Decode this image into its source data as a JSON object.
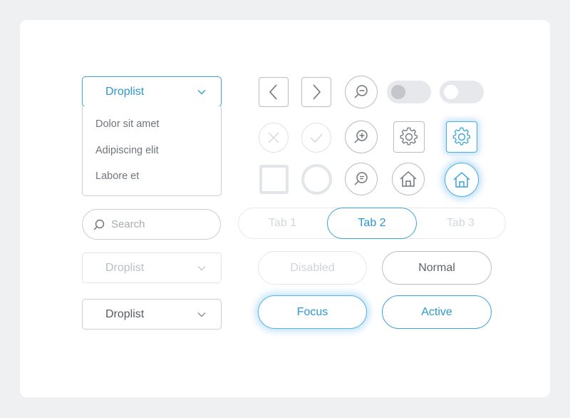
{
  "colors": {
    "accent": "#3ba3d8",
    "border": "#c9ced3",
    "disabled": "#e2e5e8",
    "background": "#eef0f2"
  },
  "dropdown_open": {
    "label": "Droplist",
    "icon": "chevron-down-icon",
    "options": [
      "Dolor sit amet",
      "Adipiscing elit",
      "Labore et"
    ]
  },
  "search": {
    "placeholder": "Search",
    "icon": "search-icon"
  },
  "dropdown_disabled": {
    "label": "Droplist",
    "icon": "chevron-down-icon"
  },
  "dropdown_normal": {
    "label": "Droplist",
    "icon": "chevron-down-icon"
  },
  "icons": {
    "row1": [
      "chevron-left-icon",
      "chevron-right-icon",
      "zoom-out-icon",
      "toggle-off",
      "toggle-off-white"
    ],
    "row2": [
      "close-icon",
      "check-icon",
      "zoom-in-icon",
      "gear-icon",
      "gear-icon-focused"
    ],
    "row3": [
      "empty-square",
      "empty-circle",
      "chat-search-icon",
      "home-icon",
      "home-icon-focused"
    ]
  },
  "tabs": {
    "items": [
      "Tab 1",
      "Tab 2",
      "Tab 3"
    ],
    "active_label": "Tab 2"
  },
  "buttons": {
    "disabled_label": "Disabled",
    "normal_label": "Normal",
    "focus_label": "Focus",
    "active_label": "Active"
  }
}
